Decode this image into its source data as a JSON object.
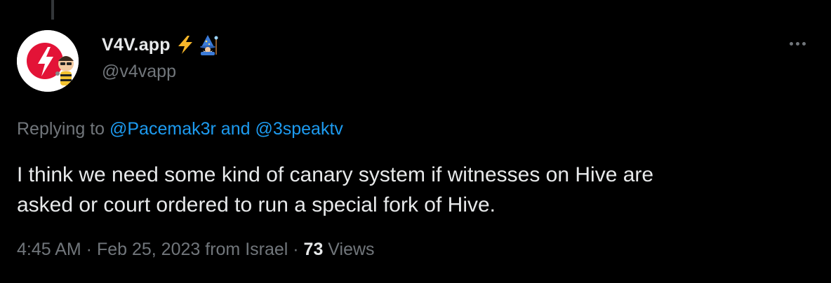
{
  "author": {
    "display_name": "V4V.app",
    "name_emojis": [
      "lightning-icon",
      "wizard-icon"
    ],
    "handle": "@v4vapp"
  },
  "reply": {
    "prefix": "Replying to ",
    "mention_1": "@Pacemak3r",
    "connector": " and ",
    "mention_2": "@3speaktv"
  },
  "tweet": {
    "line_1": "I think we need some kind of canary system if witnesses on Hive are",
    "line_2": "asked or court ordered to run a special fork of Hive."
  },
  "meta": {
    "time": "4:45 AM",
    "separator_1": " · ",
    "date": "Feb 25, 2023",
    "location": " from Israel",
    "separator_2": " · ",
    "views_count": "73",
    "views_label": " Views"
  },
  "colors": {
    "background": "#000000",
    "text_primary": "#e7e9ea",
    "text_secondary": "#71767b",
    "link": "#1d9bf0",
    "hive_red": "#e31337"
  }
}
